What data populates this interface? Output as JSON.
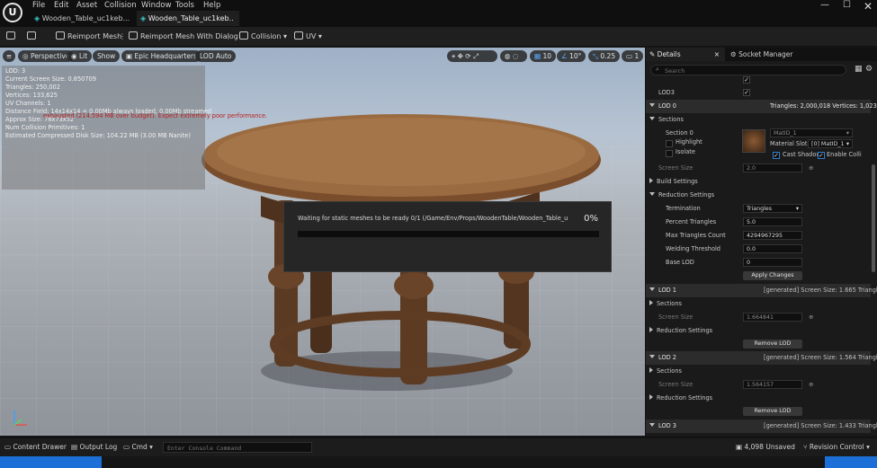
{
  "menu": [
    "File",
    "Edit",
    "Asset",
    "Collision",
    "Window",
    "Tools",
    "Help"
  ],
  "tabs": [
    {
      "label": "Wooden_Table_uc1keb..."
    },
    {
      "label": "Wooden_Table_uc1keb.. •"
    }
  ],
  "toolbar": {
    "reimport": "Reimport Mesh",
    "reimport_dialog": "Reimport Mesh With Dialog",
    "collision": "Collision",
    "uv": "UV"
  },
  "viewport": {
    "perspective": "Perspective",
    "lit": "Lit",
    "show": "Show",
    "preview_scene": "Epic Headquarters",
    "lod": "LOD Auto",
    "grid_snap": "10",
    "rot_snap": "10°",
    "scale_snap": "0.25",
    "camera_speed": "1",
    "stats": [
      "LOD: 3",
      "Current Screen Size: 0.850709",
      "Triangles: 250,002",
      "Vertices: 133,625",
      "UV Channels: 1",
      "Distance Field: 14x14x14 = 0.00Mb always loaded, 0.00Mb streamed",
      "Approx Size: 78x73x52",
      "Num Collision Primitives: 1",
      "Estimated Compressed Disk Size: 104.22 MB (3.00 MB Nanite)"
    ],
    "warning": "exhausted (214.594 MB over budget). Expect extremely poor performance."
  },
  "progress": {
    "text": "Waiting for static meshes to be ready 0/1 (/Game/Env/Props/WoodenTable/Wooden_Table_uc1kebzfa_LOD) ...",
    "percent": "0%",
    "value": 0
  },
  "details": {
    "tab": "Details",
    "socket_tab": "Socket Manager",
    "search_placeholder": "Search",
    "lod_top": "LOD3",
    "lod0": {
      "title": "LOD 0",
      "stats": "Triangles: 2,000,018   Vertices: 1,023,68",
      "sections": "Sections",
      "section0": "Section 0",
      "highlight": "Highlight",
      "isolate": "Isolate",
      "material": "MatID_1",
      "material_slot_label": "Material Slot",
      "material_slot": "[0] MatID_1",
      "cast_shadow": "Cast Shadow",
      "enable_collision": "Enable Colli",
      "screen_size_label": "Screen Size",
      "screen_size": "2.0",
      "build_settings": "Build Settings",
      "reduction_settings": "Reduction Settings",
      "termination_label": "Termination",
      "termination": "Triangles",
      "percent_triangles_label": "Percent Triangles",
      "percent_triangles": "5.0",
      "max_triangles_label": "Max Triangles Count",
      "max_triangles": "4294967295",
      "welding_label": "Welding Threshold",
      "welding": "0.0",
      "base_lod_label": "Base LOD",
      "base_lod": "0",
      "apply": "Apply Changes"
    },
    "lod1": {
      "title": "LOD 1",
      "gen": "[generated]   Screen Size: 1.665   Triangle",
      "sections": "Sections",
      "screen_size_label": "Screen Size",
      "screen_size": "1.664841",
      "reduction": "Reduction Settings",
      "remove": "Remove LOD"
    },
    "lod2": {
      "title": "LOD 2",
      "gen": "[generated]   Screen Size: 1.564   Triangle",
      "sections": "Sections",
      "screen_size_label": "Screen Size",
      "screen_size": "1.564157",
      "reduction": "Reduction Settings",
      "remove": "Remove LOD"
    },
    "lod3": {
      "title": "LOD 3",
      "gen": "[generated]   Screen Size: 1.433   Triangle"
    }
  },
  "statusbar": {
    "content_drawer": "Content Drawer",
    "output_log": "Output Log",
    "cmd": "Cmd",
    "console_placeholder": "Enter Console Command",
    "unsaved": "4,098 Unsaved",
    "revision": "Revision Control"
  },
  "colors": {
    "accent": "#1b8af0",
    "warning": "#b81e1e"
  }
}
